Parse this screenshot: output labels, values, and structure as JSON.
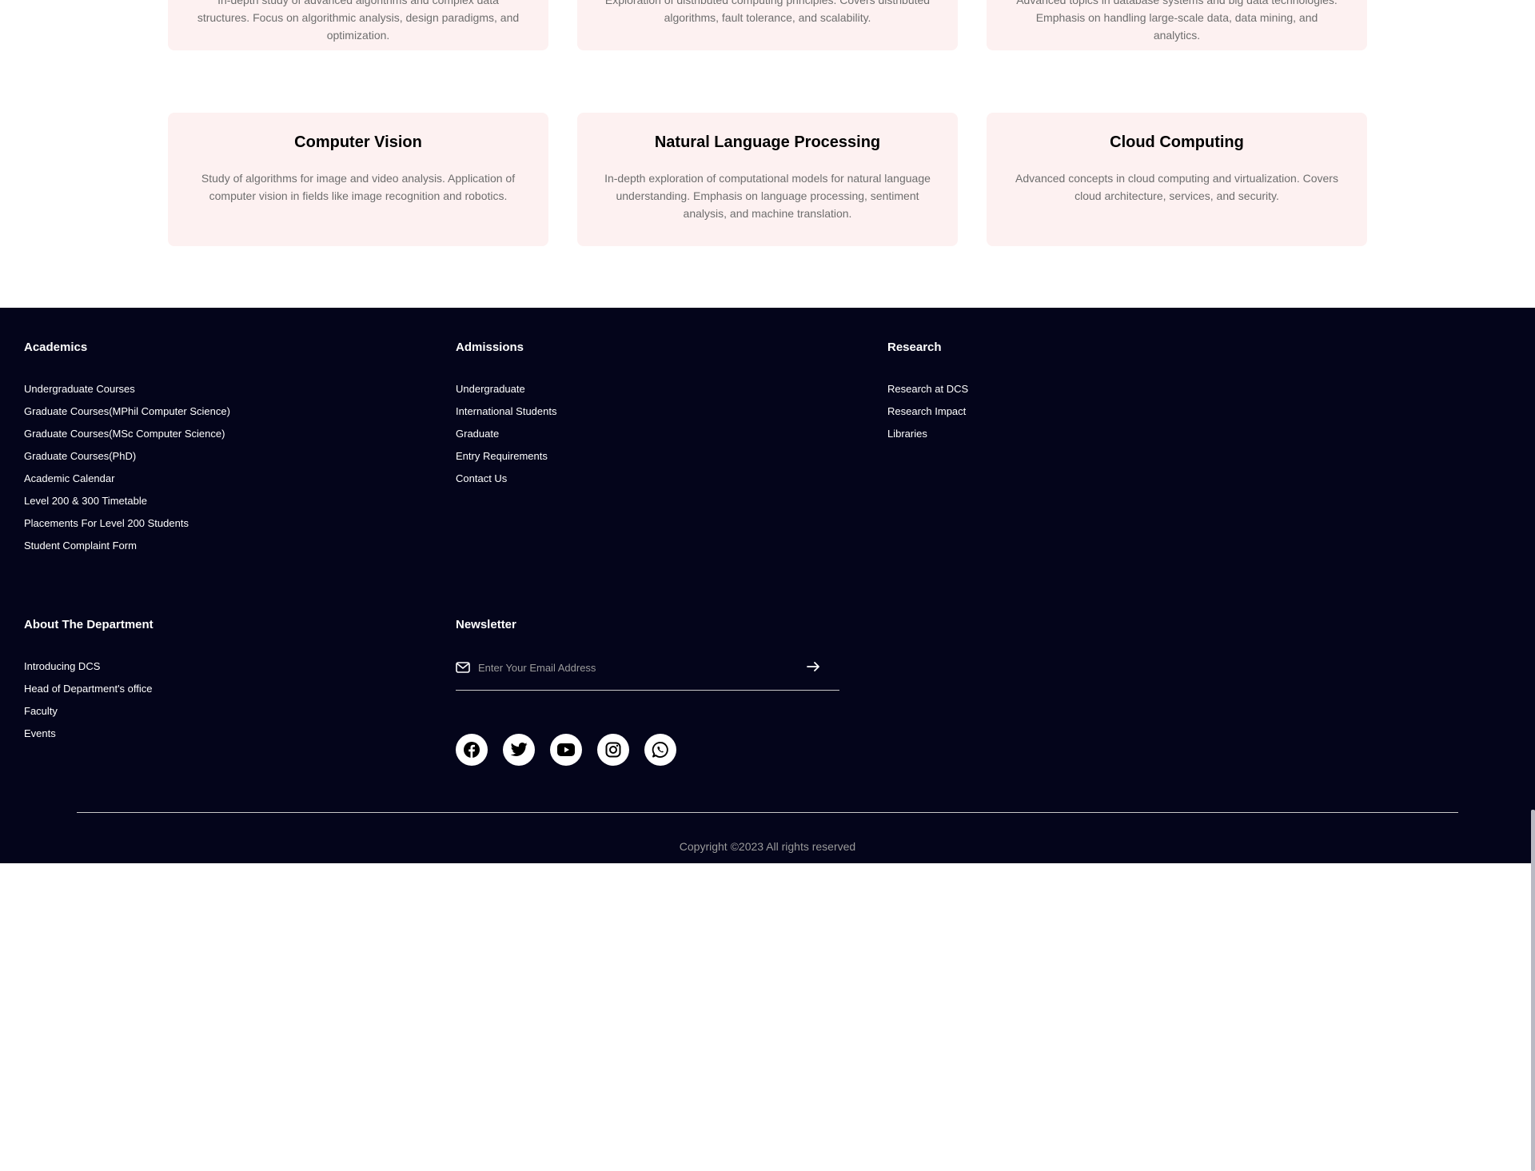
{
  "courses": {
    "row1": [
      {
        "title": "",
        "description": "In-depth study of advanced algorithms and complex data structures. Focus on algorithmic analysis, design paradigms, and optimization."
      },
      {
        "title": "",
        "description": "Exploration of distributed computing principles. Covers distributed algorithms, fault tolerance, and scalability."
      },
      {
        "title": "",
        "description": "Advanced topics in database systems and big data technologies. Emphasis on handling large-scale data, data mining, and analytics."
      }
    ],
    "row2": [
      {
        "title": "Computer Vision",
        "description": "Study of algorithms for image and video analysis. Application of computer vision in fields like image recognition and robotics."
      },
      {
        "title": "Natural Language Processing",
        "description": "In-depth exploration of computational models for natural language understanding. Emphasis on language processing, sentiment analysis, and machine translation."
      },
      {
        "title": "Cloud Computing",
        "description": "Advanced concepts in cloud computing and virtualization. Covers cloud architecture, services, and security."
      }
    ]
  },
  "footer": {
    "academics": {
      "title": "Academics",
      "links": [
        "Undergraduate Courses",
        "Graduate Courses(MPhil Computer Science)",
        "Graduate Courses(MSc Computer Science)",
        "Graduate Courses(PhD)",
        "Academic Calendar",
        "Level 200 & 300 Timetable",
        "Placements For Level 200 Students",
        "Student Complaint Form"
      ]
    },
    "admissions": {
      "title": "Admissions",
      "links": [
        "Undergraduate",
        "International Students",
        "Graduate",
        "Entry Requirements",
        "Contact Us"
      ]
    },
    "research": {
      "title": "Research",
      "links": [
        "Research at DCS",
        "Research Impact",
        "Libraries"
      ]
    },
    "about": {
      "title": "About The Department",
      "links": [
        "Introducing DCS",
        "Head of Department's office",
        "Faculty",
        "Events"
      ]
    },
    "newsletter": {
      "title": "Newsletter",
      "placeholder": "Enter Your Email Address",
      "value": ""
    },
    "socials": [
      "facebook-icon",
      "twitter-icon",
      "youtube-icon",
      "instagram-icon",
      "whatsapp-icon"
    ],
    "copyright": "Copyright ©2023 All rights reserved"
  },
  "colors": {
    "card_bg": "#fdf1f1",
    "footer_bg": "#04051b",
    "footer_text": "#ffffff",
    "muted_text": "#6e6e6e"
  }
}
